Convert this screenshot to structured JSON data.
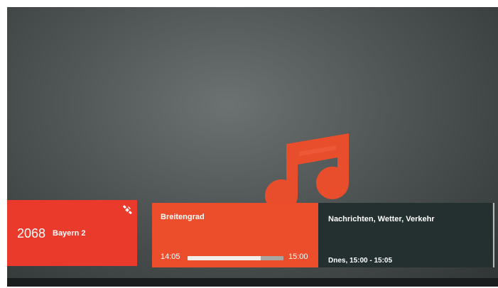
{
  "channel": {
    "number": "2068",
    "name": "Bayern 2",
    "icon": "satellite-icon"
  },
  "current_program": {
    "title": "Breitengrad",
    "start_time": "14:05",
    "end_time": "15:00",
    "progress": 0.76
  },
  "next_program": {
    "title": "Nachrichten, Wetter, Verkehr",
    "time": "Dnes, 15:00 - 15:05"
  },
  "background": {
    "icon": "music-note-icon"
  },
  "colors": {
    "channel_panel": "#ea3a2b",
    "program_panel": "#ec4d2a",
    "next_panel": "#243030",
    "music_icon": "#e84e2c",
    "progress_fill": "#f1eee9",
    "progress_track": "#a9a5a1"
  }
}
